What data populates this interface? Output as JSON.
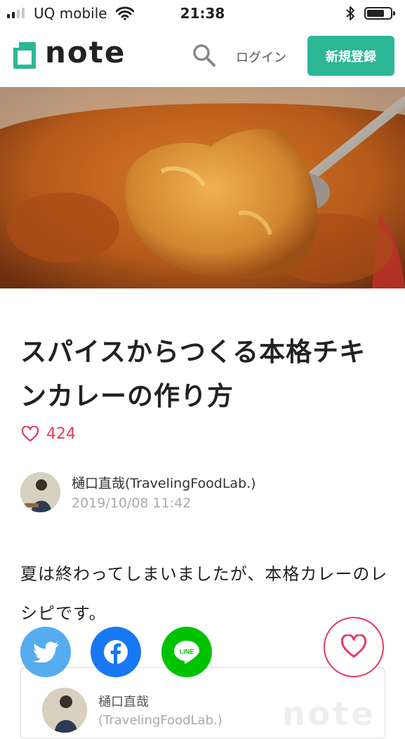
{
  "status_bar": {
    "carrier": "UQ mobile",
    "time": "21:38"
  },
  "header": {
    "logo_text": "note",
    "login_label": "ログイン",
    "signup_label": "新規登録",
    "brand_color": "#2cb696"
  },
  "article": {
    "title": "スパイスからつくる本格チキンカレーの作り方",
    "likes": "424",
    "author": "樋口直哉(TravelingFoodLab.)",
    "date": "2019/10/08 11:42",
    "body": "夏は終わってしまいましたが、本格カレーのレシピです。"
  },
  "creator_card": {
    "name": "樋口直哉",
    "name_line2": "(TravelingFoodLab.)",
    "watermark": "note"
  },
  "share": {
    "icons": [
      "twitter-icon",
      "facebook-icon",
      "line-icon"
    ],
    "line_label": "LINE"
  },
  "accent_color": "#e63a62"
}
